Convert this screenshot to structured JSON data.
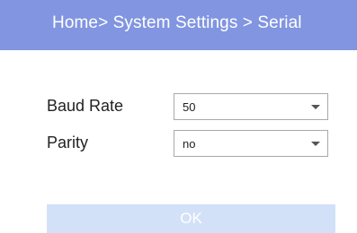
{
  "header": {
    "breadcrumb": "Home> System Settings > Serial",
    "background_color": "#8195e0"
  },
  "form": {
    "baud_rate": {
      "label": "Baud Rate",
      "value": "50",
      "icon": "chevron-down-icon"
    },
    "parity": {
      "label": "Parity",
      "value": "no",
      "icon": "chevron-down-icon"
    }
  },
  "actions": {
    "ok_label": "OK",
    "ok_color": "#d3e1f8"
  }
}
